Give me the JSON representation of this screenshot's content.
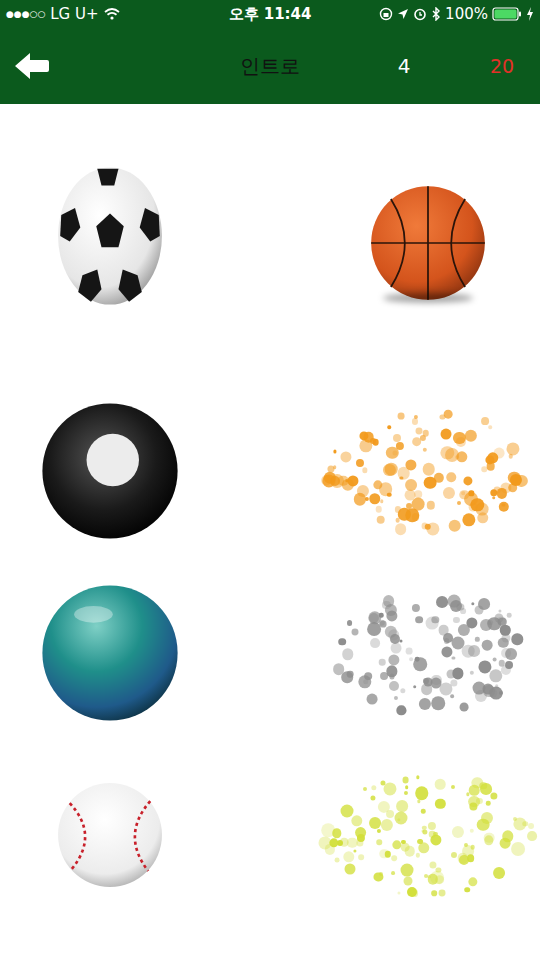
{
  "status_bar": {
    "signal": "●●●○○",
    "carrier": "LG U+",
    "time": "오후 11:44",
    "battery": "100%"
  },
  "header": {
    "title": "인트로",
    "count": "4",
    "total": "20"
  },
  "rows": [
    {
      "left": {
        "kind": "soccer"
      },
      "right": {
        "kind": "basketball"
      }
    },
    {
      "left": {
        "kind": "billiard"
      },
      "right": {
        "kind": "burst",
        "color": "#f29a1c"
      }
    },
    {
      "left": {
        "kind": "bowling"
      },
      "right": {
        "kind": "burst",
        "color": "#8c8c8c"
      }
    },
    {
      "left": {
        "kind": "baseball"
      },
      "right": {
        "kind": "burst",
        "color": "#d2df3a"
      }
    }
  ]
}
